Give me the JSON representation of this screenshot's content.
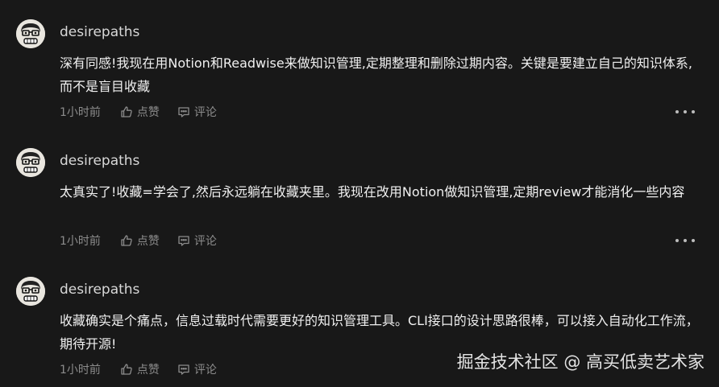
{
  "comments": [
    {
      "username": "desirepaths",
      "content": "深有同感!我现在用Notion和Readwise来做知识管理,定期整理和删除过期内容。关键是要建立自己的知识体系,而不是盲目收藏",
      "time": "1小时前",
      "like_label": "点赞",
      "comment_label": "评论"
    },
    {
      "username": "desirepaths",
      "content": "太真实了!收藏=学会了,然后永远躺在收藏夹里。我现在改用Notion做知识管理,定期review才能消化一些内容",
      "time": "1小时前",
      "like_label": "点赞",
      "comment_label": "评论"
    },
    {
      "username": "desirepaths",
      "content": "收藏确实是个痛点，信息过载时代需要更好的知识管理工具。CLI接口的设计思路很棒，可以接入自动化工作流，期待开源!",
      "time": "1小时前",
      "like_label": "点赞",
      "comment_label": "评论"
    }
  ],
  "watermark": "掘金技术社区 @ 高买低卖艺术家",
  "icons": {
    "avatar": "avatar-cartoon-face",
    "like": "thumbs-up-icon",
    "comment": "comment-bubble-icon",
    "more": "more-dots-icon"
  },
  "colors": {
    "background": "#181818",
    "text": "#f0f0f0",
    "muted": "#8c8c8c"
  }
}
